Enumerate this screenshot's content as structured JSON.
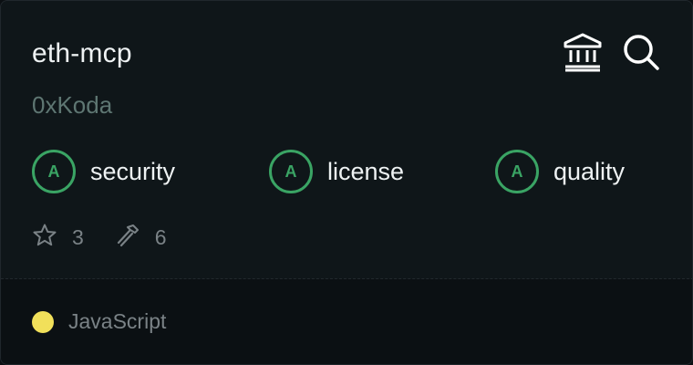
{
  "repo": {
    "name": "eth-mcp",
    "owner": "0xKoda"
  },
  "actions": {
    "bank_icon": "bank-icon",
    "search_icon": "search-icon"
  },
  "scores": [
    {
      "grade": "A",
      "label": "security"
    },
    {
      "grade": "A",
      "label": "license"
    },
    {
      "grade": "A",
      "label": "quality"
    }
  ],
  "stats": {
    "stars": "3",
    "tools": "6"
  },
  "language": {
    "name": "JavaScript",
    "color": "#f1e05a"
  },
  "colors": {
    "grade_accent": "#3aa464",
    "background": "#0f1619"
  }
}
